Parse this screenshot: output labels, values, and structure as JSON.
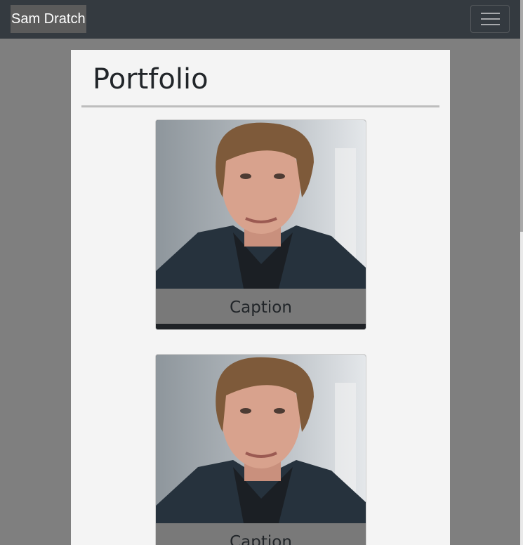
{
  "navbar": {
    "brand": "Sam Dratch",
    "toggler_icon": "hamburger-icon"
  },
  "page": {
    "title": "Portfolio"
  },
  "cards": [
    {
      "caption": "Caption",
      "image": "portrait-photo"
    },
    {
      "caption": "Caption",
      "image": "portrait-photo"
    }
  ],
  "colors": {
    "navbar_bg": "#343a40",
    "page_bg": "#7f7f7f",
    "panel_bg": "#f4f4f4",
    "caption_bg": "#808080"
  }
}
